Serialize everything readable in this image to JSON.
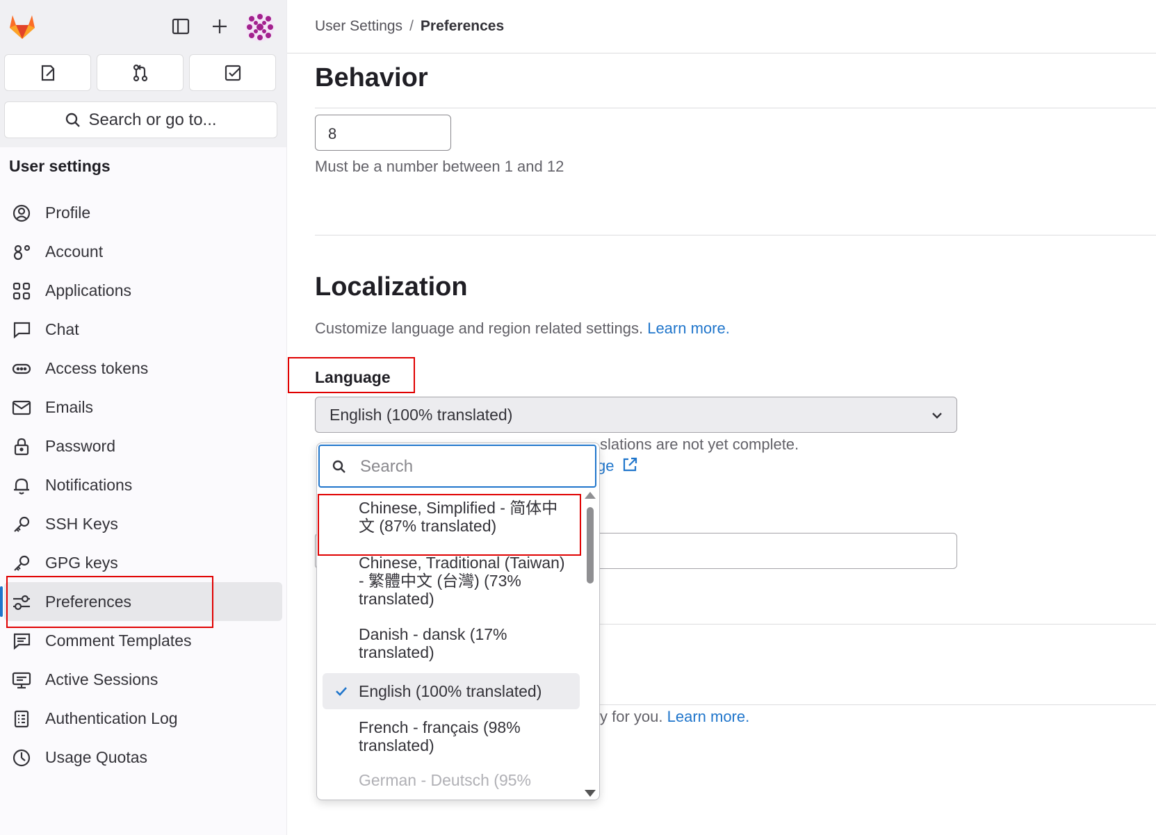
{
  "app": {
    "accent": "#1f75cb",
    "danger_box": "#e00000"
  },
  "header": {
    "quick_actions": [
      "todo-icon",
      "merge-request-icon",
      "issues-icon"
    ],
    "search_label": "Search or go to..."
  },
  "sidebar": {
    "heading": "User settings",
    "items": [
      {
        "label": "Profile",
        "icon": "profile-icon"
      },
      {
        "label": "Account",
        "icon": "account-icon"
      },
      {
        "label": "Applications",
        "icon": "applications-icon"
      },
      {
        "label": "Chat",
        "icon": "chat-icon"
      },
      {
        "label": "Access tokens",
        "icon": "token-icon"
      },
      {
        "label": "Emails",
        "icon": "mail-icon"
      },
      {
        "label": "Password",
        "icon": "lock-icon"
      },
      {
        "label": "Notifications",
        "icon": "bell-icon"
      },
      {
        "label": "SSH Keys",
        "icon": "key-icon"
      },
      {
        "label": "GPG keys",
        "icon": "key-icon"
      },
      {
        "label": "Preferences",
        "icon": "preferences-icon",
        "active": true
      },
      {
        "label": "Comment Templates",
        "icon": "comment-icon"
      },
      {
        "label": "Active Sessions",
        "icon": "monitor-icon"
      },
      {
        "label": "Authentication Log",
        "icon": "log-icon"
      },
      {
        "label": "Usage Quotas",
        "icon": "quota-icon"
      }
    ]
  },
  "breadcrumb": {
    "parent": "User Settings",
    "separator": "/",
    "current": "Preferences"
  },
  "behavior": {
    "title": "Behavior",
    "number_value": "8",
    "number_help": "Must be a number between 1 and 12"
  },
  "localization": {
    "title": "Localization",
    "description": "Customize language and region related settings.",
    "learn_more": "Learn more.",
    "language_label": "Language",
    "language_selected": "English (100% translated)",
    "translation_note_visible": "slations are not yet complete.",
    "translation_link_visible": "ge",
    "tracking_visible": "y for you.",
    "tracking_link": "Learn more."
  },
  "dropdown": {
    "search_placeholder": "Search",
    "options": [
      {
        "label": "Chinese, Simplified - 简体中文 (87% translated)"
      },
      {
        "label": "Chinese, Traditional (Taiwan) - 繁體中文 (台灣) (73% translated)"
      },
      {
        "label": "Danish - dansk (17% translated)"
      },
      {
        "label": "English (100% translated)",
        "selected": true
      },
      {
        "label": "French - français (98% translated)"
      },
      {
        "label": "German - Deutsch (95%"
      }
    ]
  }
}
